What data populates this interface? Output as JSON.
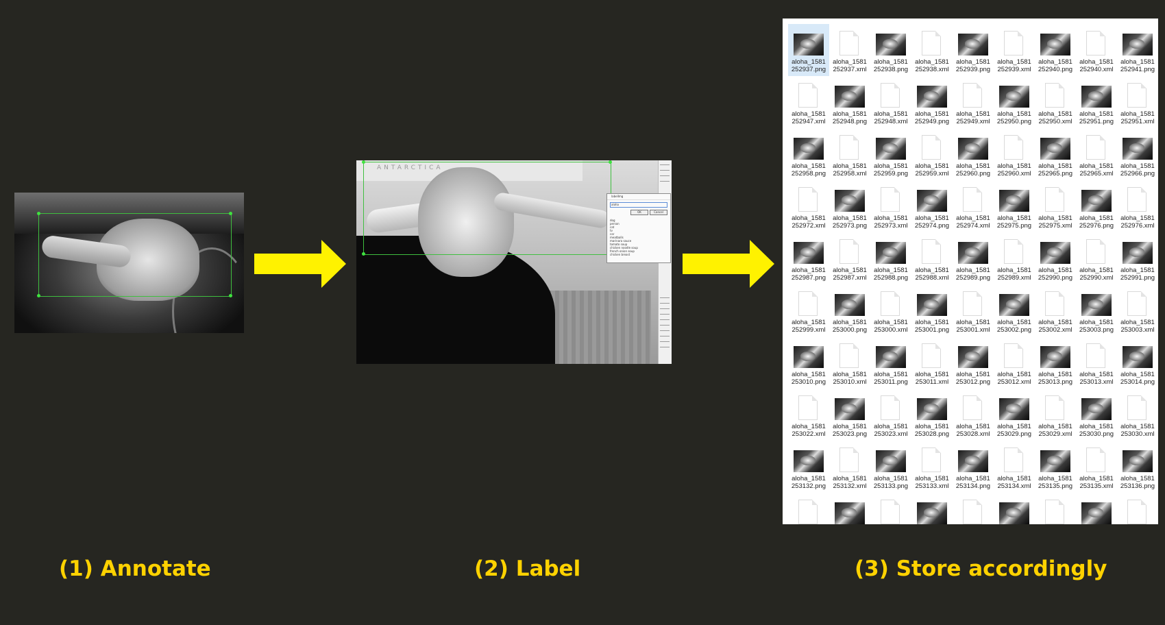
{
  "colors": {
    "background": "#262621",
    "arrow": "#fff200",
    "caption": "#ffd200",
    "bounding_box": "#3fbf3f"
  },
  "steps": [
    {
      "caption": "(1) Annotate"
    },
    {
      "caption": "(2) Label"
    },
    {
      "caption": "(3) Store accordingly"
    }
  ],
  "label_tool": {
    "wall_text": "ANTARCTICA",
    "dialog_title": "labelImg",
    "input_value": "aloha",
    "ok_label": "OK",
    "cancel_label": "Cancel",
    "label_list": [
      "dog",
      "person",
      "cat",
      "tv",
      "car",
      "meatballs",
      "marinara sauce",
      "tomato soup",
      "chicken noodle soup",
      "french onion soup",
      "chicken breast"
    ]
  },
  "files": [
    {
      "name": "aloha_1581 252937.png",
      "kind": "png",
      "selected": true
    },
    {
      "name": "aloha_1581 252937.xml",
      "kind": "xml"
    },
    {
      "name": "aloha_1581 252938.png",
      "kind": "png"
    },
    {
      "name": "aloha_1581 252938.xml",
      "kind": "xml"
    },
    {
      "name": "aloha_1581 252939.png",
      "kind": "png"
    },
    {
      "name": "aloha_1581 252939.xml",
      "kind": "xml"
    },
    {
      "name": "aloha_1581 252940.png",
      "kind": "png"
    },
    {
      "name": "aloha_1581 252940.xml",
      "kind": "xml"
    },
    {
      "name": "aloha_1581 252941.png",
      "kind": "png"
    },
    {
      "name": "aloha_1581 252947.xml",
      "kind": "xml"
    },
    {
      "name": "aloha_1581 252948.png",
      "kind": "png"
    },
    {
      "name": "aloha_1581 252948.xml",
      "kind": "xml"
    },
    {
      "name": "aloha_1581 252949.png",
      "kind": "png"
    },
    {
      "name": "aloha_1581 252949.xml",
      "kind": "xml"
    },
    {
      "name": "aloha_1581 252950.png",
      "kind": "png"
    },
    {
      "name": "aloha_1581 252950.xml",
      "kind": "xml"
    },
    {
      "name": "aloha_1581 252951.png",
      "kind": "png"
    },
    {
      "name": "aloha_1581 252951.xml",
      "kind": "xml"
    },
    {
      "name": "aloha_1581 252958.png",
      "kind": "png"
    },
    {
      "name": "aloha_1581 252958.xml",
      "kind": "xml"
    },
    {
      "name": "aloha_1581 252959.png",
      "kind": "png"
    },
    {
      "name": "aloha_1581 252959.xml",
      "kind": "xml"
    },
    {
      "name": "aloha_1581 252960.png",
      "kind": "png"
    },
    {
      "name": "aloha_1581 252960.xml",
      "kind": "xml"
    },
    {
      "name": "aloha_1581 252965.png",
      "kind": "png"
    },
    {
      "name": "aloha_1581 252965.xml",
      "kind": "xml"
    },
    {
      "name": "aloha_1581 252966.png",
      "kind": "png"
    },
    {
      "name": "aloha_1581 252972.xml",
      "kind": "xml"
    },
    {
      "name": "aloha_1581 252973.png",
      "kind": "png"
    },
    {
      "name": "aloha_1581 252973.xml",
      "kind": "xml"
    },
    {
      "name": "aloha_1581 252974.png",
      "kind": "png"
    },
    {
      "name": "aloha_1581 252974.xml",
      "kind": "xml"
    },
    {
      "name": "aloha_1581 252975.png",
      "kind": "png"
    },
    {
      "name": "aloha_1581 252975.xml",
      "kind": "xml"
    },
    {
      "name": "aloha_1581 252976.png",
      "kind": "png"
    },
    {
      "name": "aloha_1581 252976.xml",
      "kind": "xml"
    },
    {
      "name": "aloha_1581 252987.png",
      "kind": "png"
    },
    {
      "name": "aloha_1581 252987.xml",
      "kind": "xml"
    },
    {
      "name": "aloha_1581 252988.png",
      "kind": "png"
    },
    {
      "name": "aloha_1581 252988.xml",
      "kind": "xml"
    },
    {
      "name": "aloha_1581 252989.png",
      "kind": "png"
    },
    {
      "name": "aloha_1581 252989.xml",
      "kind": "xml"
    },
    {
      "name": "aloha_1581 252990.png",
      "kind": "png"
    },
    {
      "name": "aloha_1581 252990.xml",
      "kind": "xml"
    },
    {
      "name": "aloha_1581 252991.png",
      "kind": "png"
    },
    {
      "name": "aloha_1581 252999.xml",
      "kind": "xml"
    },
    {
      "name": "aloha_1581 253000.png",
      "kind": "png"
    },
    {
      "name": "aloha_1581 253000.xml",
      "kind": "xml"
    },
    {
      "name": "aloha_1581 253001.png",
      "kind": "png"
    },
    {
      "name": "aloha_1581 253001.xml",
      "kind": "xml"
    },
    {
      "name": "aloha_1581 253002.png",
      "kind": "png"
    },
    {
      "name": "aloha_1581 253002.xml",
      "kind": "xml"
    },
    {
      "name": "aloha_1581 253003.png",
      "kind": "png"
    },
    {
      "name": "aloha_1581 253003.xml",
      "kind": "xml"
    },
    {
      "name": "aloha_1581 253010.png",
      "kind": "png"
    },
    {
      "name": "aloha_1581 253010.xml",
      "kind": "xml"
    },
    {
      "name": "aloha_1581 253011.png",
      "kind": "png"
    },
    {
      "name": "aloha_1581 253011.xml",
      "kind": "xml"
    },
    {
      "name": "aloha_1581 253012.png",
      "kind": "png"
    },
    {
      "name": "aloha_1581 253012.xml",
      "kind": "xml"
    },
    {
      "name": "aloha_1581 253013.png",
      "kind": "png"
    },
    {
      "name": "aloha_1581 253013.xml",
      "kind": "xml"
    },
    {
      "name": "aloha_1581 253014.png",
      "kind": "png"
    },
    {
      "name": "aloha_1581 253022.xml",
      "kind": "xml"
    },
    {
      "name": "aloha_1581 253023.png",
      "kind": "png"
    },
    {
      "name": "aloha_1581 253023.xml",
      "kind": "xml"
    },
    {
      "name": "aloha_1581 253028.png",
      "kind": "png"
    },
    {
      "name": "aloha_1581 253028.xml",
      "kind": "xml"
    },
    {
      "name": "aloha_1581 253029.png",
      "kind": "png"
    },
    {
      "name": "aloha_1581 253029.xml",
      "kind": "xml"
    },
    {
      "name": "aloha_1581 253030.png",
      "kind": "png"
    },
    {
      "name": "aloha_1581 253030.xml",
      "kind": "xml"
    },
    {
      "name": "aloha_1581 253132.png",
      "kind": "png"
    },
    {
      "name": "aloha_1581 253132.xml",
      "kind": "xml"
    },
    {
      "name": "aloha_1581 253133.png",
      "kind": "png"
    },
    {
      "name": "aloha_1581 253133.xml",
      "kind": "xml"
    },
    {
      "name": "aloha_1581 253134.png",
      "kind": "png"
    },
    {
      "name": "aloha_1581 253134.xml",
      "kind": "xml"
    },
    {
      "name": "aloha_1581 253135.png",
      "kind": "png"
    },
    {
      "name": "aloha_1581 253135.xml",
      "kind": "xml"
    },
    {
      "name": "aloha_1581 253136.png",
      "kind": "png"
    },
    {
      "name": "",
      "kind": "xml"
    },
    {
      "name": "",
      "kind": "png"
    },
    {
      "name": "",
      "kind": "xml"
    },
    {
      "name": "",
      "kind": "png"
    },
    {
      "name": "",
      "kind": "xml"
    },
    {
      "name": "",
      "kind": "png"
    },
    {
      "name": "",
      "kind": "xml"
    },
    {
      "name": "",
      "kind": "png"
    },
    {
      "name": "",
      "kind": "xml"
    }
  ]
}
